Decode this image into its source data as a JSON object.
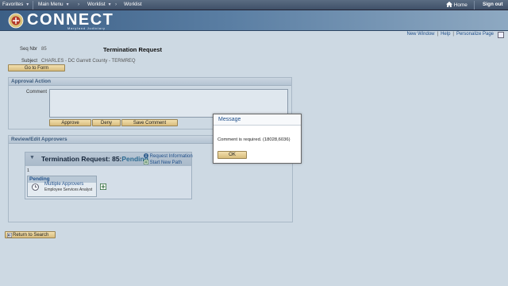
{
  "nav": {
    "favorites": "Favorites",
    "main_menu": "Main Menu",
    "crumb_1": "Worklist",
    "crumb_2": "Worklist",
    "home": "Home",
    "sign_out": "Sign out"
  },
  "banner": {
    "brand": "CONNECT",
    "subtitle": "Maryland Judiciary"
  },
  "util_links": [
    "New Window",
    "Help",
    "Personalize Page"
  ],
  "header": {
    "seq_label": "Seq Nbr",
    "seq_value": "85",
    "title": "Termination Request",
    "subject_label": "Subject",
    "subject_value": "CHARLES - DC Garrett County - TERMREQ",
    "go_to_form": "Go to Form"
  },
  "approval_action": {
    "heading": "Approval Action",
    "comment_label": "Comment",
    "approve": "Approve",
    "deny": "Deny",
    "save_comment": "Save Comment"
  },
  "review": {
    "heading": "Review/Edit Approvers",
    "path_title": "Termination Request: 85:",
    "path_status": "Pending",
    "request_info": "Request Information",
    "start_new_path": "Start New Path",
    "step_number": "1",
    "stage_status": "Pending",
    "approver_name": "Multiple Approvers",
    "approver_role": "Employee Services Analyst"
  },
  "return_to_search": "Return to Search",
  "modal": {
    "title": "Message",
    "message": "Comment is required. (18028,6036)",
    "ok": "OK"
  },
  "colors": {
    "nav_bg": "#4b5d75",
    "banner_bg": "#4f739a",
    "page_bg": "#cdd9e3",
    "button_bg": "#e6cf96",
    "link": "#1f4f8a"
  }
}
